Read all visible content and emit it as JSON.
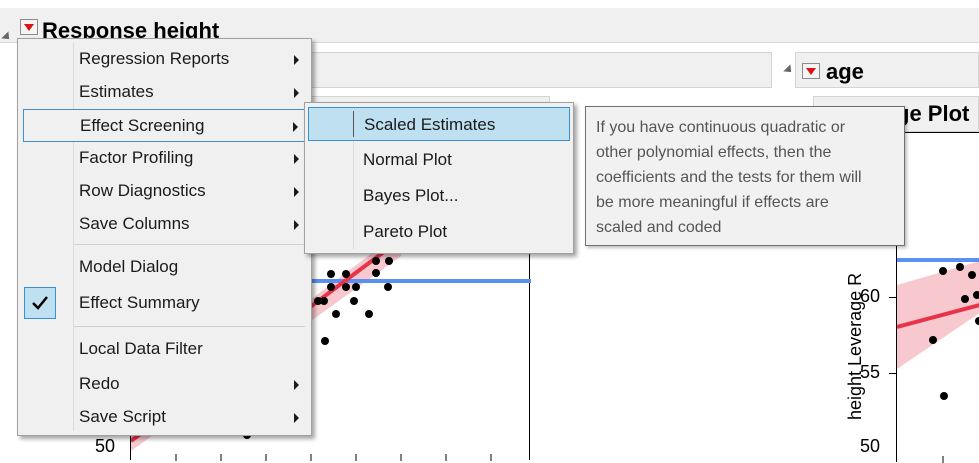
{
  "report": {
    "title": "Response height"
  },
  "right_outline": {
    "title": "age",
    "plot_title_partial": "ge Plot"
  },
  "left_plot": {
    "y_tick": "50"
  },
  "right_plot": {
    "ylabel": "height Leverage R",
    "y_ticks": [
      "60",
      "55",
      "50"
    ]
  },
  "menu": {
    "items": [
      {
        "label": "Regression Reports",
        "submenu": true
      },
      {
        "label": "Estimates",
        "submenu": true
      },
      {
        "label": "Effect Screening",
        "submenu": true,
        "highlighted": true
      },
      {
        "label": "Factor Profiling",
        "submenu": true
      },
      {
        "label": "Row Diagnostics",
        "submenu": true
      },
      {
        "label": "Save Columns",
        "submenu": true
      },
      {
        "label": "Model Dialog",
        "submenu": false
      },
      {
        "label": "Effect Summary",
        "submenu": false,
        "checked": true
      },
      {
        "label": "Local Data Filter",
        "submenu": false
      },
      {
        "label": "Redo",
        "submenu": true
      },
      {
        "label": "Save Script",
        "submenu": true
      }
    ]
  },
  "submenu": {
    "items": [
      {
        "label": "Scaled Estimates",
        "highlighted": true
      },
      {
        "label": "Normal Plot"
      },
      {
        "label": "Bayes Plot..."
      },
      {
        "label": "Pareto Plot"
      }
    ]
  },
  "tooltip": {
    "lines": [
      "If you have continuous quadratic or",
      "other polynomial effects, then the",
      "coefficients and the tests for them will",
      "be more meaningful if effects are",
      "scaled and coded"
    ]
  },
  "colors": {
    "fit_line": "#e8334a",
    "confidence_band": "#f7c9cf",
    "mean_line": "#5b8ff0",
    "highlight_border": "#3c8fd0",
    "highlight_fill": "#bfe0f0",
    "red_triangle": "#dd1111"
  }
}
